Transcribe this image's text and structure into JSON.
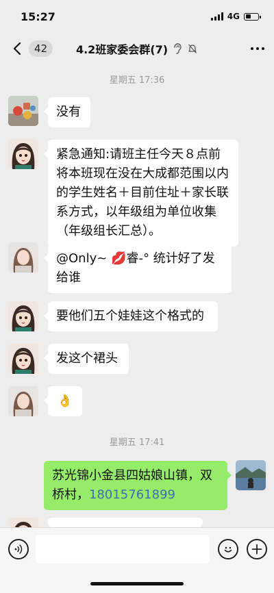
{
  "status": {
    "time": "15:27",
    "network": "4G",
    "battery_level": 0.45
  },
  "nav": {
    "unread_count": "42",
    "title": "4.2班家委会群(7)"
  },
  "separators": [
    "星期五 17:36",
    "星期五 17:41"
  ],
  "messages": [
    {
      "sender": "other",
      "avatar": "toys-avatar",
      "text": "没有"
    },
    {
      "sender": "other",
      "avatar": "cartoon-girl-avatar",
      "text": "紧急通知:请班主任今天８点前将本班现在没在大成都范围以内的学生姓名＋目前住址＋家长联系方式，以年级组为单位收集（年级组长汇总）。"
    },
    {
      "sender": "other",
      "avatar": "girl-photo-avatar",
      "text": "@Only~ 💋睿-° 统计好了发给谁"
    },
    {
      "sender": "other",
      "avatar": "cartoon-girl-avatar",
      "text": "要他们五个娃娃这个格式的"
    },
    {
      "sender": "other",
      "avatar": "cartoon-girl-avatar",
      "text": "发这个裙头"
    },
    {
      "sender": "other",
      "avatar": "girl-photo-avatar",
      "text": "👌"
    },
    {
      "sender": "me",
      "avatar": "lake-photo-avatar",
      "text": "苏光锦小金县四姑娘山镇，双桥村，",
      "phone": "18015761899"
    }
  ],
  "input": {
    "placeholder": ""
  },
  "colors": {
    "background": "#ededed",
    "my_bubble": "#95ec69",
    "link": "#3a6fb0"
  }
}
